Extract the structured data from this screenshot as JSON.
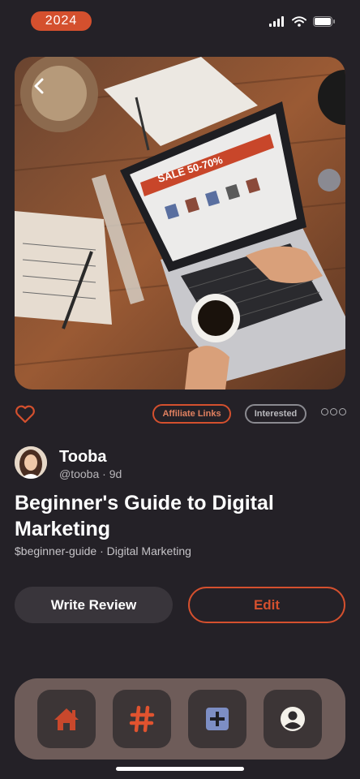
{
  "status_bar": {
    "year": "2024"
  },
  "post": {
    "tags": {
      "affiliate": "Affiliate Links",
      "interested": "Interested"
    },
    "author": {
      "name": "Tooba",
      "meta": "@tooba · 9d"
    },
    "title": "Beginner's Guide to Digital Marketing",
    "subtitle": "$beginner-guide · Digital Marketing",
    "hero_screen_text": "SALE 50-70%"
  },
  "actions": {
    "review_label": "Write Review",
    "edit_label": "Edit"
  },
  "colors": {
    "accent": "#d4502e",
    "background": "#242127",
    "tab_bar": "#6e5c59"
  },
  "tab_bar": {
    "icons": [
      "home-icon",
      "hashtag-icon",
      "plus-square-icon",
      "profile-icon"
    ]
  }
}
